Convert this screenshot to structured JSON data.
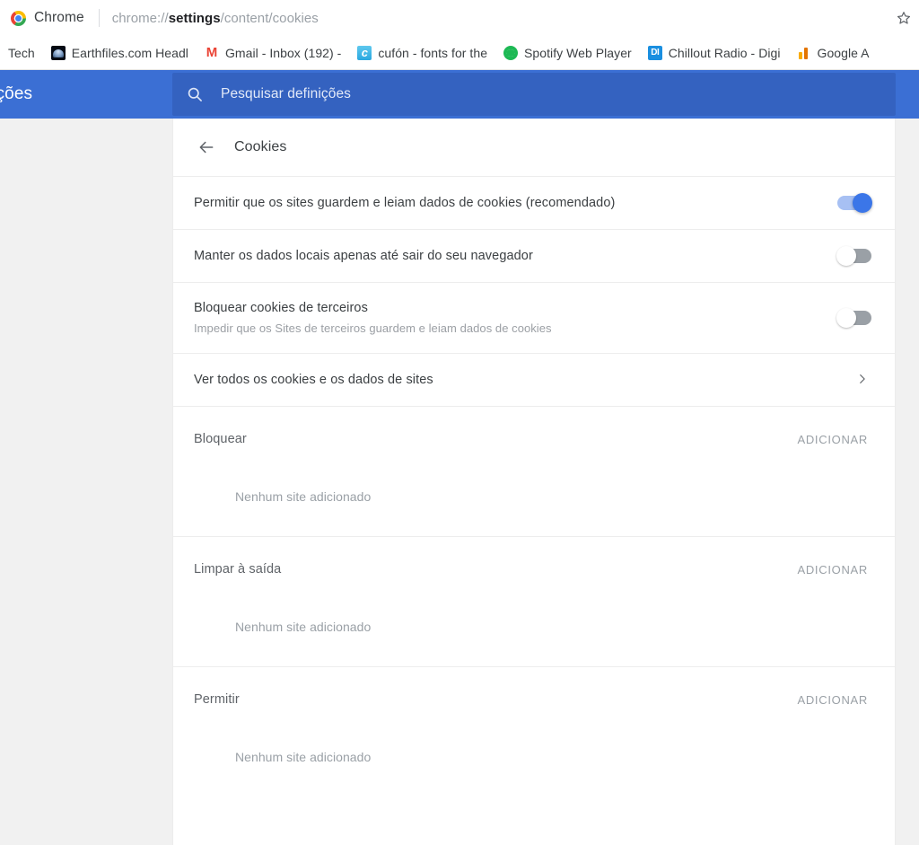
{
  "browser": {
    "app_name": "Chrome",
    "url_prefix": "chrome://",
    "url_bold": "settings",
    "url_suffix": "/content/cookies",
    "star_icon": "star-outline-icon",
    "bookmarks": [
      {
        "label": "Tech",
        "icon": "folder-icon",
        "icon_class": "none"
      },
      {
        "label": "Earthfiles.com Headl",
        "icon": "earthfiles-favicon",
        "icon_class": "earthfiles",
        "icon_text": ""
      },
      {
        "label": "Gmail - Inbox (192) -",
        "icon": "gmail-favicon",
        "icon_class": "gmail",
        "icon_text": "M"
      },
      {
        "label": "cufón - fonts for the",
        "icon": "cufon-favicon",
        "icon_class": "cufon",
        "icon_text": "c"
      },
      {
        "label": "Spotify Web Player",
        "icon": "spotify-favicon",
        "icon_class": "spotify",
        "icon_text": ""
      },
      {
        "label": "Chillout Radio - Digi",
        "icon": "digitally-imported-favicon",
        "icon_class": "digitally",
        "icon_text": "DI"
      },
      {
        "label": "Google A",
        "icon": "google-analytics-favicon",
        "icon_class": "analytics",
        "icon_text": ""
      }
    ]
  },
  "settings_header": {
    "title_clipped": "Definições",
    "search_icon": "search-icon",
    "search_placeholder": "Pesquisar definições",
    "search_value": "",
    "header_color": "#3b6fd4",
    "search_bg_color": "#3462c0"
  },
  "card": {
    "back_icon": "back-arrow-icon",
    "title": "Cookies",
    "rows": [
      {
        "label": "Permitir que os sites guardem e leiam dados de cookies (recomendado)",
        "sub": "",
        "control": "toggle",
        "state": "on"
      },
      {
        "label": "Manter os dados locais apenas até sair do seu navegador",
        "sub": "",
        "control": "toggle",
        "state": "off"
      },
      {
        "label": "Bloquear cookies de terceiros",
        "sub": "Impedir que os Sites de terceiros guardem e leiam dados de cookies",
        "control": "toggle",
        "state": "off"
      },
      {
        "label": "Ver todos os cookies e os dados de sites",
        "sub": "",
        "control": "chevron",
        "state": ""
      }
    ],
    "exceptions": [
      {
        "title": "Bloquear",
        "add_label": "ADICIONAR",
        "empty_label": "Nenhum site adicionado"
      },
      {
        "title": "Limpar à saída",
        "add_label": "ADICIONAR",
        "empty_label": "Nenhum site adicionado"
      },
      {
        "title": "Permitir",
        "add_label": "ADICIONAR",
        "empty_label": "Nenhum site adicionado"
      }
    ]
  },
  "colors": {
    "accent_blue": "#3b76e8",
    "toggle_on_track": "#a7c0f3",
    "toggle_off_track": "#9aa0a6",
    "page_bg": "#f1f1f1"
  }
}
